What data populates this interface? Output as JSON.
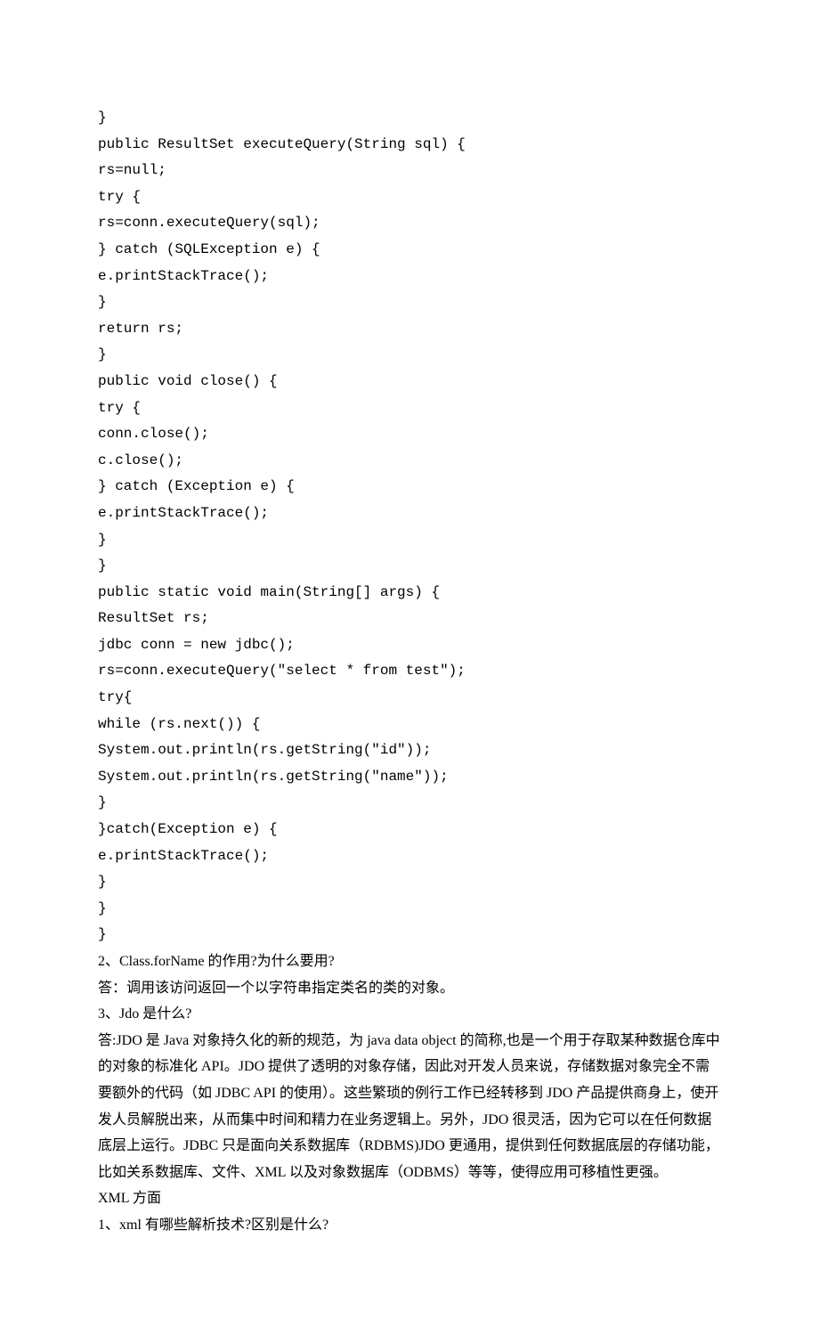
{
  "lines": [
    {
      "t": "}",
      "c": "code"
    },
    {
      "t": "public ResultSet executeQuery(String sql) {",
      "c": "code"
    },
    {
      "t": "rs=null;",
      "c": "code"
    },
    {
      "t": "try {",
      "c": "code"
    },
    {
      "t": "rs=conn.executeQuery(sql);",
      "c": "code"
    },
    {
      "t": "} catch (SQLException e) {",
      "c": "code"
    },
    {
      "t": "e.printStackTrace();",
      "c": "code"
    },
    {
      "t": "}",
      "c": "code"
    },
    {
      "t": "return rs;",
      "c": "code"
    },
    {
      "t": "}",
      "c": "code"
    },
    {
      "t": "public void close() {",
      "c": "code"
    },
    {
      "t": "try {",
      "c": "code"
    },
    {
      "t": "conn.close();",
      "c": "code"
    },
    {
      "t": "c.close();",
      "c": "code"
    },
    {
      "t": "} catch (Exception e) {",
      "c": "code"
    },
    {
      "t": "e.printStackTrace();",
      "c": "code"
    },
    {
      "t": "}",
      "c": "code"
    },
    {
      "t": "}",
      "c": "code"
    },
    {
      "t": "public static void main(String[] args) {",
      "c": "code"
    },
    {
      "t": "ResultSet rs;",
      "c": "code"
    },
    {
      "t": "jdbc conn = new jdbc();",
      "c": "code"
    },
    {
      "t": "rs=conn.executeQuery(\"select * from test\");",
      "c": "code"
    },
    {
      "t": "try{",
      "c": "code"
    },
    {
      "t": "while (rs.next()) {",
      "c": "code"
    },
    {
      "t": "System.out.println(rs.getString(\"id\"));",
      "c": "code"
    },
    {
      "t": "System.out.println(rs.getString(\"name\"));",
      "c": "code"
    },
    {
      "t": "}",
      "c": "code"
    },
    {
      "t": "}catch(Exception e) {",
      "c": "code"
    },
    {
      "t": "e.printStackTrace();",
      "c": "code"
    },
    {
      "t": "}",
      "c": "code"
    },
    {
      "t": "}",
      "c": "code"
    },
    {
      "t": "}",
      "c": "code"
    },
    {
      "t": "2、Class.forName 的作用?为什么要用?",
      "c": "text"
    },
    {
      "t": "答：调用该访问返回一个以字符串指定类名的类的对象。",
      "c": "text"
    },
    {
      "t": "3、Jdo 是什么?",
      "c": "text"
    },
    {
      "t": "答:JDO 是 Java 对象持久化的新的规范，为 java data object 的简称,也是一个用于存取某种数据仓库中的对象的标准化 API。JDO 提供了透明的对象存储，因此对开发人员来说，存储数据对象完全不需要额外的代码（如 JDBC API 的使用）。这些繁琐的例行工作已经转移到 JDO 产品提供商身上，使开发人员解脱出来，从而集中时间和精力在业务逻辑上。另外，JDO 很灵活，因为它可以在任何数据底层上运行。JDBC 只是面向关系数据库（RDBMS)JDO 更通用，提供到任何数据底层的存储功能，比如关系数据库、文件、XML 以及对象数据库（ODBMS）等等，使得应用可移植性更强。",
      "c": "text"
    },
    {
      "t": "XML 方面",
      "c": "text"
    },
    {
      "t": "1、xml 有哪些解析技术?区别是什么?",
      "c": "text"
    }
  ]
}
